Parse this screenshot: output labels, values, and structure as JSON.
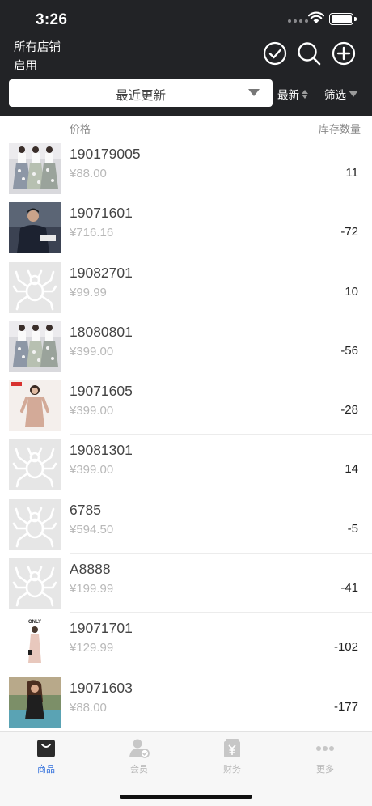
{
  "status": {
    "time": "3:26"
  },
  "header": {
    "store_name": "所有店铺",
    "store_status": "启用",
    "sort_select_label": "最近更新",
    "order_label": "最新",
    "filter_label": "筛选"
  },
  "columns": {
    "price": "价格",
    "stock": "库存数量"
  },
  "products": [
    {
      "code": "190179005",
      "price": "¥88.00",
      "stock": "11",
      "thumb": "dress-floral"
    },
    {
      "code": "19071601",
      "price": "¥716.16",
      "stock": "-72",
      "thumb": "man-jacket"
    },
    {
      "code": "19082701",
      "price": "¥99.99",
      "stock": "10",
      "thumb": "placeholder-spider"
    },
    {
      "code": "18080801",
      "price": "¥399.00",
      "stock": "-56",
      "thumb": "dress-floral"
    },
    {
      "code": "19071605",
      "price": "¥399.00",
      "stock": "-28",
      "thumb": "pink-dress"
    },
    {
      "code": "19081301",
      "price": "¥399.00",
      "stock": "14",
      "thumb": "placeholder-spider"
    },
    {
      "code": "6785",
      "price": "¥594.50",
      "stock": "-5",
      "thumb": "placeholder-spider"
    },
    {
      "code": "A8888",
      "price": "¥199.99",
      "stock": "-41",
      "thumb": "placeholder-spider"
    },
    {
      "code": "19071701",
      "price": "¥129.99",
      "stock": "-102",
      "thumb": "only-dress"
    },
    {
      "code": "19071603",
      "price": "¥88.00",
      "stock": "-177",
      "thumb": "outdoor-woman"
    }
  ],
  "tabs": [
    {
      "label": "商品",
      "icon": "bag-icon",
      "active": true
    },
    {
      "label": "会员",
      "icon": "member-icon",
      "active": false
    },
    {
      "label": "财务",
      "icon": "finance-icon",
      "active": false
    },
    {
      "label": "更多",
      "icon": "more-icon",
      "active": false
    }
  ],
  "colors": {
    "header_bg": "#222326",
    "active_tab": "#2f6edc",
    "price_gray": "#b8b8b8"
  }
}
